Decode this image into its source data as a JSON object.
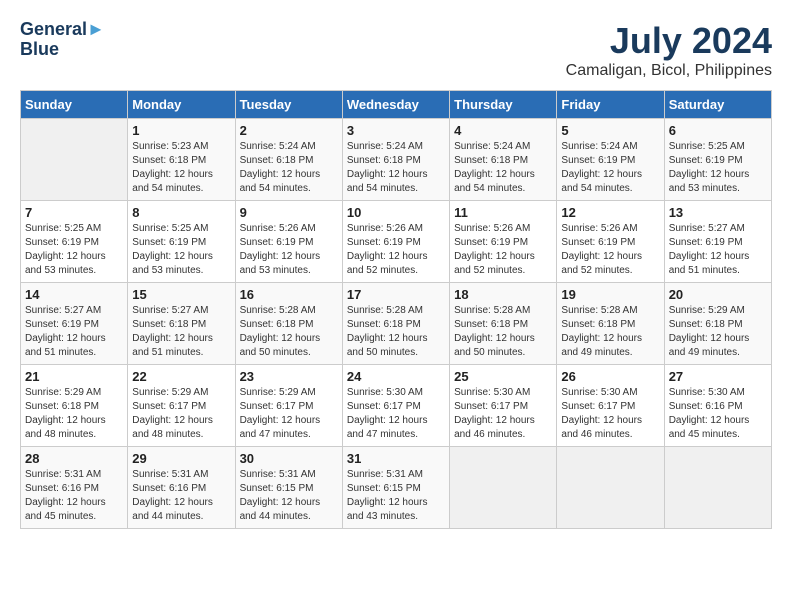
{
  "header": {
    "logo_line1": "General",
    "logo_line2": "Blue",
    "month_year": "July 2024",
    "location": "Camaligan, Bicol, Philippines"
  },
  "calendar": {
    "days_of_week": [
      "Sunday",
      "Monday",
      "Tuesday",
      "Wednesday",
      "Thursday",
      "Friday",
      "Saturday"
    ],
    "weeks": [
      [
        {
          "day": "",
          "info": ""
        },
        {
          "day": "1",
          "info": "Sunrise: 5:23 AM\nSunset: 6:18 PM\nDaylight: 12 hours\nand 54 minutes."
        },
        {
          "day": "2",
          "info": "Sunrise: 5:24 AM\nSunset: 6:18 PM\nDaylight: 12 hours\nand 54 minutes."
        },
        {
          "day": "3",
          "info": "Sunrise: 5:24 AM\nSunset: 6:18 PM\nDaylight: 12 hours\nand 54 minutes."
        },
        {
          "day": "4",
          "info": "Sunrise: 5:24 AM\nSunset: 6:18 PM\nDaylight: 12 hours\nand 54 minutes."
        },
        {
          "day": "5",
          "info": "Sunrise: 5:24 AM\nSunset: 6:19 PM\nDaylight: 12 hours\nand 54 minutes."
        },
        {
          "day": "6",
          "info": "Sunrise: 5:25 AM\nSunset: 6:19 PM\nDaylight: 12 hours\nand 53 minutes."
        }
      ],
      [
        {
          "day": "7",
          "info": "Sunrise: 5:25 AM\nSunset: 6:19 PM\nDaylight: 12 hours\nand 53 minutes."
        },
        {
          "day": "8",
          "info": "Sunrise: 5:25 AM\nSunset: 6:19 PM\nDaylight: 12 hours\nand 53 minutes."
        },
        {
          "day": "9",
          "info": "Sunrise: 5:26 AM\nSunset: 6:19 PM\nDaylight: 12 hours\nand 53 minutes."
        },
        {
          "day": "10",
          "info": "Sunrise: 5:26 AM\nSunset: 6:19 PM\nDaylight: 12 hours\nand 52 minutes."
        },
        {
          "day": "11",
          "info": "Sunrise: 5:26 AM\nSunset: 6:19 PM\nDaylight: 12 hours\nand 52 minutes."
        },
        {
          "day": "12",
          "info": "Sunrise: 5:26 AM\nSunset: 6:19 PM\nDaylight: 12 hours\nand 52 minutes."
        },
        {
          "day": "13",
          "info": "Sunrise: 5:27 AM\nSunset: 6:19 PM\nDaylight: 12 hours\nand 51 minutes."
        }
      ],
      [
        {
          "day": "14",
          "info": "Sunrise: 5:27 AM\nSunset: 6:19 PM\nDaylight: 12 hours\nand 51 minutes."
        },
        {
          "day": "15",
          "info": "Sunrise: 5:27 AM\nSunset: 6:18 PM\nDaylight: 12 hours\nand 51 minutes."
        },
        {
          "day": "16",
          "info": "Sunrise: 5:28 AM\nSunset: 6:18 PM\nDaylight: 12 hours\nand 50 minutes."
        },
        {
          "day": "17",
          "info": "Sunrise: 5:28 AM\nSunset: 6:18 PM\nDaylight: 12 hours\nand 50 minutes."
        },
        {
          "day": "18",
          "info": "Sunrise: 5:28 AM\nSunset: 6:18 PM\nDaylight: 12 hours\nand 50 minutes."
        },
        {
          "day": "19",
          "info": "Sunrise: 5:28 AM\nSunset: 6:18 PM\nDaylight: 12 hours\nand 49 minutes."
        },
        {
          "day": "20",
          "info": "Sunrise: 5:29 AM\nSunset: 6:18 PM\nDaylight: 12 hours\nand 49 minutes."
        }
      ],
      [
        {
          "day": "21",
          "info": "Sunrise: 5:29 AM\nSunset: 6:18 PM\nDaylight: 12 hours\nand 48 minutes."
        },
        {
          "day": "22",
          "info": "Sunrise: 5:29 AM\nSunset: 6:17 PM\nDaylight: 12 hours\nand 48 minutes."
        },
        {
          "day": "23",
          "info": "Sunrise: 5:29 AM\nSunset: 6:17 PM\nDaylight: 12 hours\nand 47 minutes."
        },
        {
          "day": "24",
          "info": "Sunrise: 5:30 AM\nSunset: 6:17 PM\nDaylight: 12 hours\nand 47 minutes."
        },
        {
          "day": "25",
          "info": "Sunrise: 5:30 AM\nSunset: 6:17 PM\nDaylight: 12 hours\nand 46 minutes."
        },
        {
          "day": "26",
          "info": "Sunrise: 5:30 AM\nSunset: 6:17 PM\nDaylight: 12 hours\nand 46 minutes."
        },
        {
          "day": "27",
          "info": "Sunrise: 5:30 AM\nSunset: 6:16 PM\nDaylight: 12 hours\nand 45 minutes."
        }
      ],
      [
        {
          "day": "28",
          "info": "Sunrise: 5:31 AM\nSunset: 6:16 PM\nDaylight: 12 hours\nand 45 minutes."
        },
        {
          "day": "29",
          "info": "Sunrise: 5:31 AM\nSunset: 6:16 PM\nDaylight: 12 hours\nand 44 minutes."
        },
        {
          "day": "30",
          "info": "Sunrise: 5:31 AM\nSunset: 6:15 PM\nDaylight: 12 hours\nand 44 minutes."
        },
        {
          "day": "31",
          "info": "Sunrise: 5:31 AM\nSunset: 6:15 PM\nDaylight: 12 hours\nand 43 minutes."
        },
        {
          "day": "",
          "info": ""
        },
        {
          "day": "",
          "info": ""
        },
        {
          "day": "",
          "info": ""
        }
      ]
    ]
  }
}
